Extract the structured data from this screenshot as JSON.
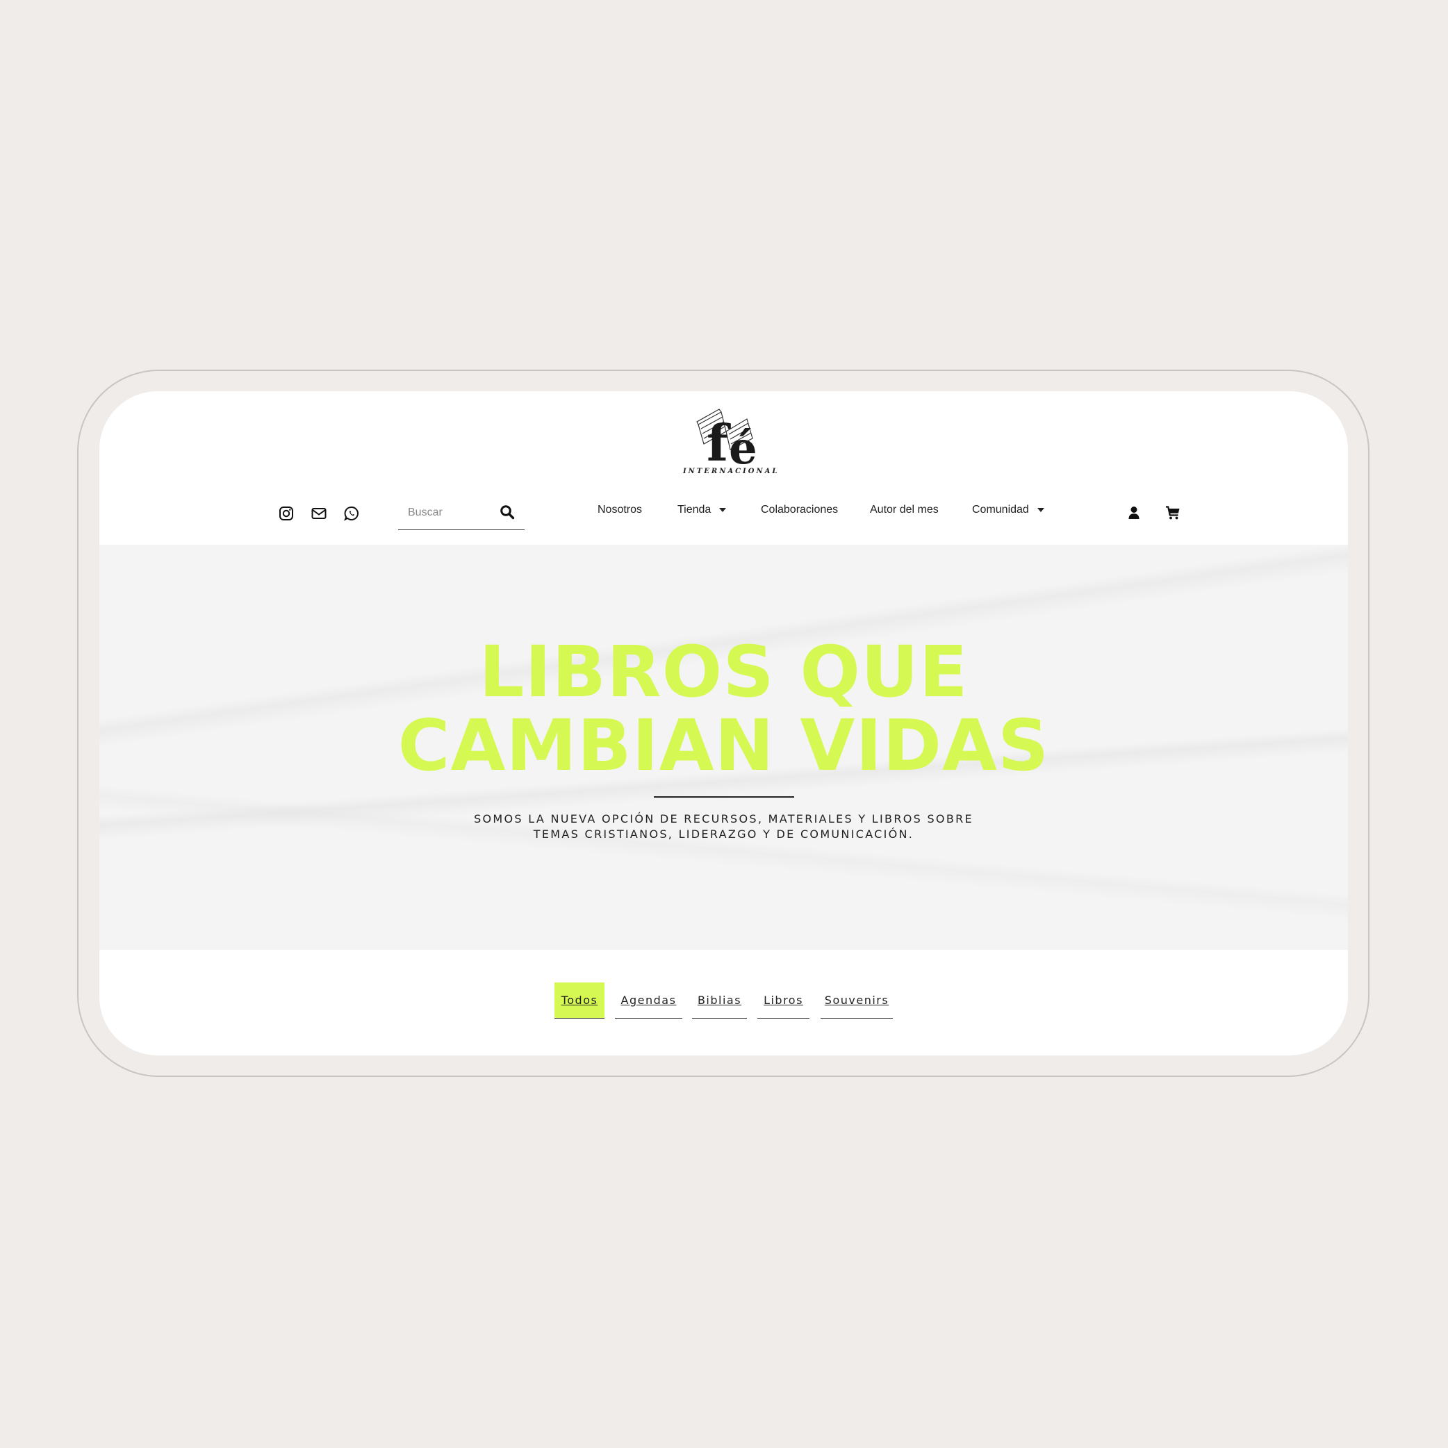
{
  "logo": {
    "wordmark": "INTERNACIONAL"
  },
  "social_icons": [
    "instagram-icon",
    "email-icon",
    "whatsapp-icon"
  ],
  "search": {
    "placeholder": "Buscar"
  },
  "nav": {
    "nosotros": "Nosotros",
    "tienda": "Tienda",
    "colaboraciones": "Colaboraciones",
    "autor": "Autor del mes",
    "comunidad": "Comunidad"
  },
  "util_icons": [
    "user-icon",
    "cart-icon"
  ],
  "hero": {
    "title_line1": "LIBROS QUE",
    "title_line2": "CAMBIAN VIDAS",
    "subtitle_line1": "SOMOS LA NUEVA OPCIÓN DE RECURSOS, MATERIALES Y LIBROS SOBRE",
    "subtitle_line2": "TEMAS CRISTIANOS, LIDERAZGO Y DE COMUNICACIÓN."
  },
  "filters": {
    "todos": "Todos",
    "agendas": "Agendas",
    "biblias": "Biblias",
    "libros": "Libros",
    "souvenirs": "Souvenirs",
    "active": "Todos"
  },
  "colors": {
    "accent": "#d5f852",
    "background": "#efece9",
    "text": "#222222"
  }
}
